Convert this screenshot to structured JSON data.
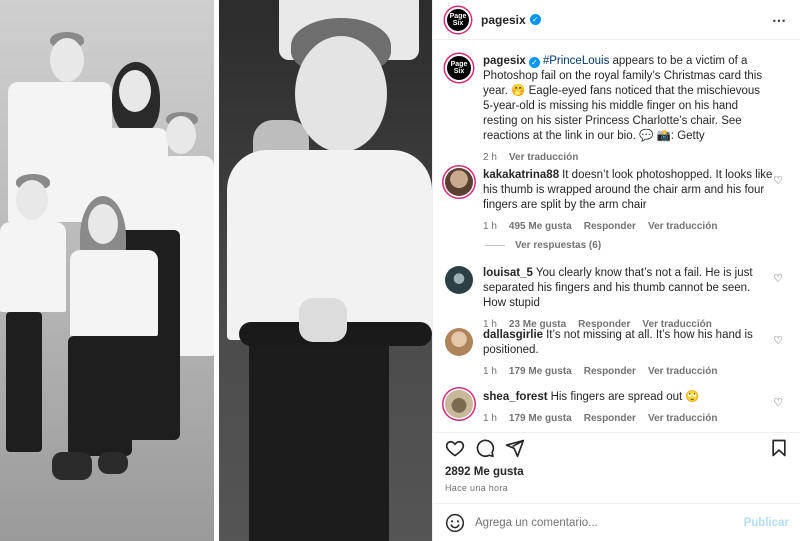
{
  "post": {
    "account": "pagesix",
    "avatar_text": "Page Six",
    "verified_mark": "✓",
    "more_icon": "⋯"
  },
  "caption": {
    "username": "pagesix",
    "hashtag": "#PrinceLouis",
    "text": " appears to be a victim of a Photoshop fail on the royal family’s Christmas card this year. 🤭 Eagle-eyed fans noticed that the mischievous 5-year-old is missing his middle finger on his hand resting on his sister Princess Charlotte’s chair. See reactions at the link in our bio. 💬 📸: Getty",
    "time": "2 h",
    "translate": "Ver traducción"
  },
  "comments": [
    {
      "username": "kakakatrina88",
      "text": "It doesn’t look photoshopped. It looks like his thumb is wrapped around the chair arm and his four fingers are split by the arm chair",
      "time": "1 h",
      "likes": "495 Me gusta",
      "reply": "Responder",
      "translate": "Ver traducción"
    },
    {
      "username": "louisat_5",
      "text": "You clearly know that’s not a fail. He is just separated his fingers and his thumb cannot be seen. How stupid",
      "time": "1 h",
      "likes": "23 Me gusta",
      "reply": "Responder",
      "translate": "Ver traducción"
    },
    {
      "username": "dallasgirlie",
      "text": "It’s not missing at all. It’s how his hand is positioned.",
      "time": "1 h",
      "likes": "179 Me gusta",
      "reply": "Responder",
      "translate": "Ver traducción"
    },
    {
      "username": "shea_forest",
      "text": "His fingers are spread out 🙄",
      "time": "1 h",
      "likes": "179 Me gusta",
      "reply": "Responder",
      "translate": "Ver traducción"
    }
  ],
  "view_replies": "Ver respuestas (6)",
  "footer": {
    "likes": "2892 Me gusta",
    "time": "Hace una hora",
    "comment_placeholder": "Agrega un comentario...",
    "post_button": "Publicar"
  },
  "icons": {
    "heart": "heart-icon",
    "comment": "comment-icon",
    "share": "share-icon",
    "save": "bookmark-icon",
    "emoji": "emoji-icon"
  },
  "colors": {
    "verified": "#0095f6",
    "link": "#00376b",
    "muted": "#737373",
    "post_disabled": "#b2dffc"
  }
}
